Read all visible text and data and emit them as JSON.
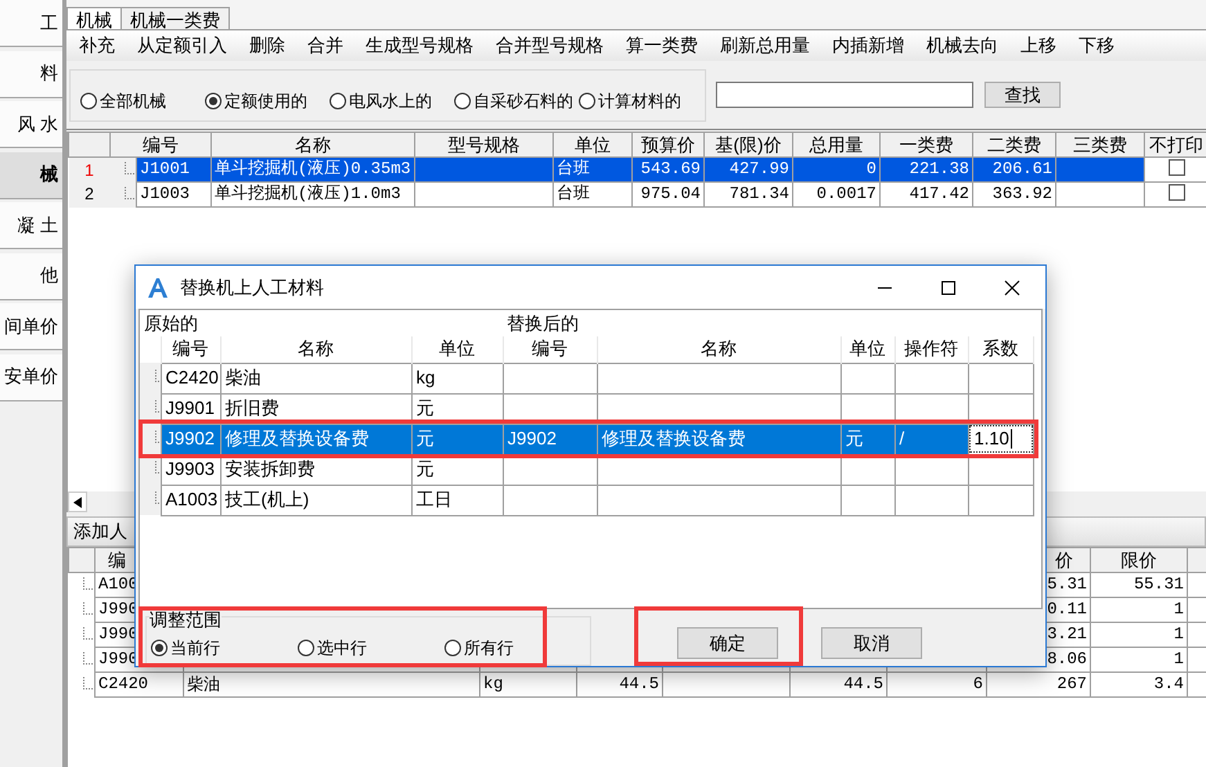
{
  "sidebar": {
    "items": [
      {
        "label": "工",
        "selected": false
      },
      {
        "label": "料",
        "selected": false
      },
      {
        "label": "风 水",
        "selected": false
      },
      {
        "label": "械",
        "selected": true
      },
      {
        "label": "凝 土",
        "selected": false
      },
      {
        "label": "他",
        "selected": false
      },
      {
        "label": "间单价",
        "selected": false
      },
      {
        "label": "安单价",
        "selected": false
      }
    ]
  },
  "tabs": [
    {
      "label": "机械",
      "selected": true
    },
    {
      "label": "机械一类费",
      "selected": false
    }
  ],
  "toolbar": [
    "补充",
    "从定额引入",
    "删除",
    "合并",
    "生成型号规格",
    "合并型号规格",
    "算一类费",
    "刷新总用量",
    "内插新增",
    "机械去向",
    "上移",
    "下移"
  ],
  "filter": {
    "options": [
      {
        "label": "全部机械",
        "selected": false
      },
      {
        "label": "定额使用的",
        "selected": true
      },
      {
        "label": "电风水上的",
        "selected": false
      },
      {
        "label": "自采砂石料的",
        "selected": false
      },
      {
        "label": "计算材料的",
        "selected": false
      }
    ],
    "search_button": "查找"
  },
  "machine_table": {
    "columns": [
      "编号",
      "名称",
      "型号规格",
      "单位",
      "预算价",
      "基(限)价",
      "总用量",
      "一类费",
      "二类费",
      "三类费",
      "不打印"
    ],
    "rows": [
      {
        "number": "1",
        "selected": true,
        "no_print": false,
        "code": "J1001",
        "name": "单斗挖掘机(液压)0.35m3",
        "unit": "台班",
        "budget_price": "543.69",
        "base_price": "427.99",
        "total_qty": "0",
        "class1_fee": "221.38",
        "class2_fee": "206.61"
      },
      {
        "number": "2",
        "selected": false,
        "no_print": false,
        "code": "J1003",
        "name": "单斗挖掘机(液压)1.0m3",
        "unit": "台班",
        "budget_price": "975.04",
        "base_price": "781.34",
        "total_qty": "0.0017",
        "class1_fee": "417.42",
        "class2_fee": "363.92"
      }
    ]
  },
  "labor_panel": {
    "title": "添加人",
    "headers": {
      "code": "编",
      "column_8": "价",
      "limit_price": "限价"
    },
    "rows": [
      {
        "code": "A100",
        "column_8": "5.31",
        "limit_price": "55.31"
      },
      {
        "code": "J990",
        "column_8": "0.11",
        "limit_price": "1"
      },
      {
        "code": "J990",
        "column_8": "3.21",
        "limit_price": "1"
      },
      {
        "code": "J990",
        "column_8": "8.06",
        "limit_price": "1"
      },
      {
        "code": "C2420",
        "name": "柴油",
        "unit": "kg",
        "column_4": "44.5",
        "column_6": "44.5",
        "column_7": "6",
        "column_8": "267",
        "limit_price": "3.4"
      }
    ]
  },
  "dialog": {
    "title": "替换机上人工材料",
    "group_original": "原始的",
    "group_replaced": "替换后的",
    "columns": [
      "编号",
      "名称",
      "单位",
      "编号",
      "名称",
      "单位",
      "操作符",
      "系数"
    ],
    "rows": [
      {
        "selected": false,
        "orig_code": "C2420",
        "orig_name": "柴油",
        "orig_unit": "kg"
      },
      {
        "selected": false,
        "orig_code": "J9901",
        "orig_name": "折旧费",
        "orig_unit": "元"
      },
      {
        "selected": true,
        "orig_code": "J9902",
        "orig_name": "修理及替换设备费",
        "orig_unit": "元",
        "new_code": "J9902",
        "new_name": "修理及替换设备费",
        "new_unit": "元",
        "operator": "/",
        "factor": "1.10"
      },
      {
        "selected": false,
        "orig_code": "J9903",
        "orig_name": "安装拆卸费",
        "orig_unit": "元"
      },
      {
        "selected": false,
        "orig_code": "A1003",
        "orig_name": "技工(机上)",
        "orig_unit": "工日"
      }
    ],
    "range": {
      "title": "调整范围",
      "options": [
        {
          "label": "当前行",
          "selected": true
        },
        {
          "label": "选中行",
          "selected": false
        },
        {
          "label": "所有行",
          "selected": false
        }
      ]
    },
    "buttons": [
      "确定",
      "取消"
    ]
  },
  "highlights": [
    {
      "kind": "row"
    },
    {
      "kind": "range"
    },
    {
      "kind": "ok"
    }
  ]
}
